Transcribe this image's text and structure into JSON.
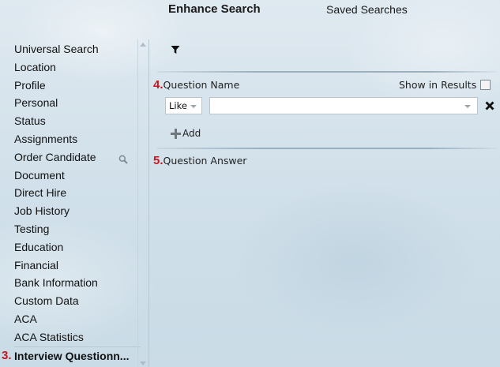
{
  "tabs": {
    "enhance_search": "Enhance Search",
    "saved_searches": "Saved Searches"
  },
  "sidebar": {
    "items": [
      {
        "label": "Universal Search"
      },
      {
        "label": "Location"
      },
      {
        "label": "Profile"
      },
      {
        "label": "Personal"
      },
      {
        "label": "Status"
      },
      {
        "label": "Assignments"
      },
      {
        "label": "Order Candidate"
      },
      {
        "label": "Document"
      },
      {
        "label": "Direct Hire"
      },
      {
        "label": "Job History"
      },
      {
        "label": "Testing"
      },
      {
        "label": "Education"
      },
      {
        "label": "Financial"
      },
      {
        "label": "Bank Information"
      },
      {
        "label": "Custom Data"
      },
      {
        "label": "ACA"
      },
      {
        "label": "ACA Statistics"
      },
      {
        "label": "Interview Questionn...",
        "step": "3.",
        "active": true
      }
    ]
  },
  "main": {
    "question_name": {
      "step": "4.",
      "label": "Question Name"
    },
    "show_in_results": {
      "label": "Show in Results",
      "checked": false
    },
    "operator": {
      "value": "Like"
    },
    "value_input": {
      "value": ""
    },
    "add_label": "Add",
    "question_answer": {
      "step": "5.",
      "label": "Question Answer"
    }
  },
  "colors": {
    "step_number": "#c8161e",
    "background": "#d3e2ec"
  },
  "icons": [
    "search-icon",
    "filter-icon",
    "close-icon",
    "plus-icon"
  ]
}
